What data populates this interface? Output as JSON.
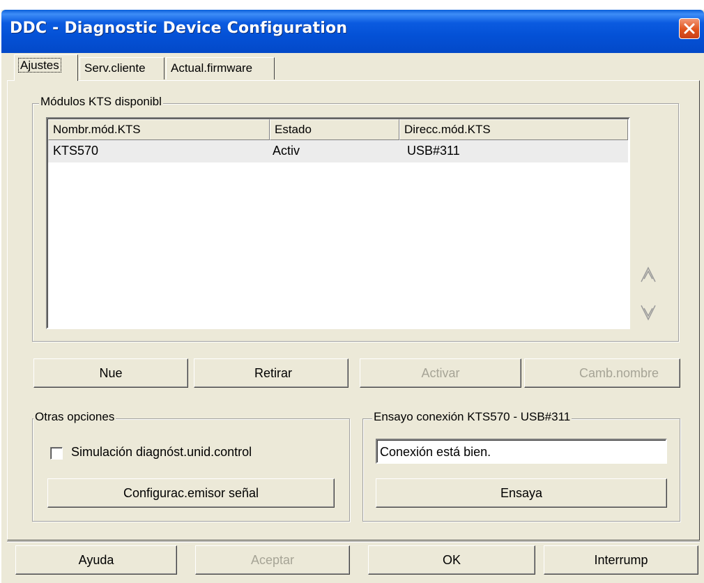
{
  "window": {
    "title": "DDC - Diagnostic Device Configuration"
  },
  "tabs": [
    {
      "label": "Ajustes",
      "active": true
    },
    {
      "label": "Serv.cliente",
      "active": false
    },
    {
      "label": "Actual.firmware",
      "active": false
    }
  ],
  "modules_group": {
    "title": "Módulos KTS disponibl",
    "columns": [
      "Nombr.mód.KTS",
      "Estado",
      "Direcc.mód.KTS"
    ],
    "rows": [
      {
        "name": "KTS570",
        "status": "Activ",
        "address": "USB#311"
      }
    ],
    "scroll_up": "up-arrow",
    "scroll_down": "down-arrow"
  },
  "module_buttons": {
    "new_label": "Nue",
    "remove_label": "Retirar",
    "activate_label": "Activar",
    "rename_label": "Camb.nombre"
  },
  "other_options": {
    "title": "Otras opciones",
    "simulation_label": "Simulación diagnóst.unid.control",
    "simulation_checked": false,
    "signal_button_label": "Configurac.emisor señal"
  },
  "connection_test": {
    "title": "Ensayo conexión  KTS570 - USB#311",
    "result_text": "Conexión está bien.",
    "test_button_label": "Ensaya"
  },
  "footer": {
    "help_label": "Ayuda",
    "accept_label": "Aceptar",
    "ok_label": "OK",
    "cancel_label": "Interrump"
  },
  "colors": {
    "titlebar": "#0451d6",
    "close_button": "#e0531d",
    "dialog_background": "#ece9d8",
    "disabled_text": "#a6a496"
  }
}
